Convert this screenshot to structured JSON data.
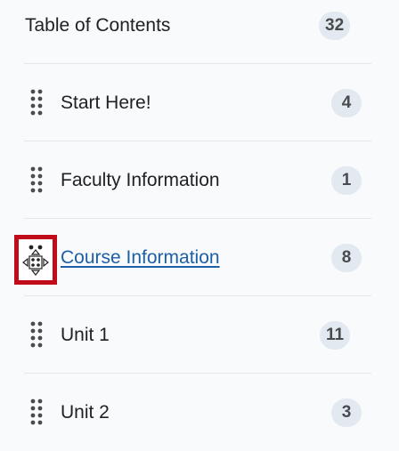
{
  "toc": {
    "header": {
      "label": "Table of Contents",
      "count": "32"
    },
    "items": [
      {
        "label": "Start Here!",
        "count": "4"
      },
      {
        "label": "Faculty Information",
        "count": "1"
      },
      {
        "label": "Course Information",
        "count": "8",
        "state": "dragging",
        "highlight_color": "#c00c1a"
      },
      {
        "label": "Unit 1",
        "count": "11"
      },
      {
        "label": "Unit 2",
        "count": "3"
      }
    ]
  },
  "colors": {
    "link": "#1c5fa6",
    "badge_bg": "#e3e9f1",
    "highlight": "#c00c1a"
  },
  "icons": {
    "drag_handle": "drag-handle-icon",
    "move_cursor": "move-cursor-icon"
  }
}
